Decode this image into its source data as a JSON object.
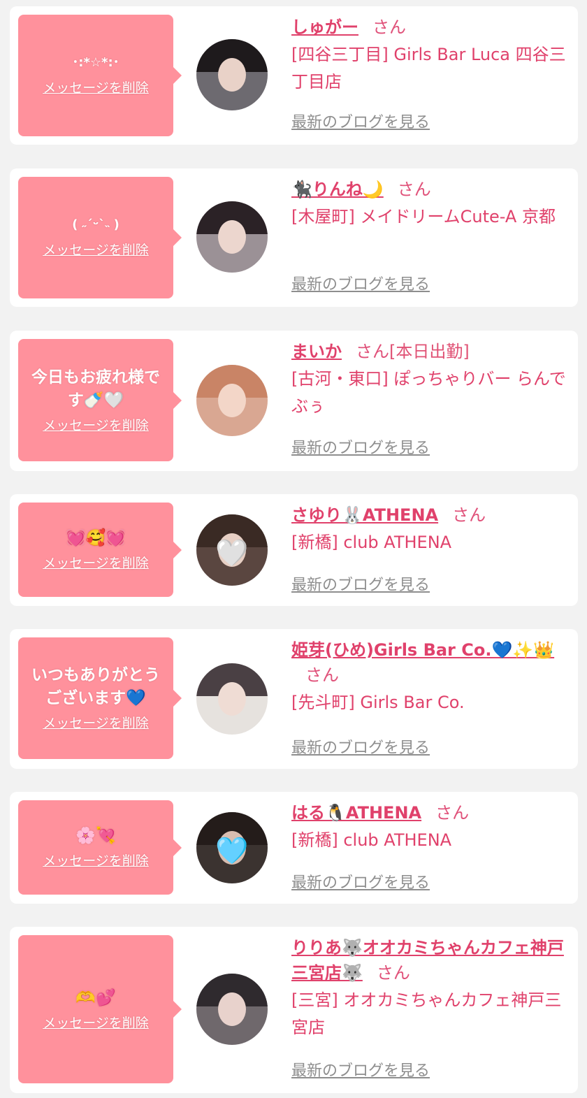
{
  "common": {
    "delete_label": "メッセージを削除",
    "blog_label": "最新のブログを見る",
    "san": "さん"
  },
  "colors": {
    "bubble": "#ff919c",
    "accent": "#e0416b",
    "muted": "#8e8e8e",
    "background": "#f2f2f2"
  },
  "messages": [
    {
      "message": "･:*☆*:･",
      "name": "しゅがー",
      "suffix": "",
      "store": "[四谷三丁目] Girls Bar Luca 四谷三丁目店",
      "avatar": {
        "hair": "#1e1a1c",
        "skin": "#e9d2c8",
        "bg": "#6d6a70",
        "sticker": ""
      }
    },
    {
      "message": "( ˶ˊᵕˋ˵ )",
      "name": "🐈‍⬛りんね🌙",
      "suffix": "",
      "store": "[木屋町] メイドリームCute-A 京都",
      "avatar": {
        "hair": "#2b2226",
        "skin": "#ecd6ce",
        "bg": "#9b9196",
        "sticker": ""
      }
    },
    {
      "message": "今日もお疲れ様です🍼🤍",
      "name": "まいか",
      "suffix": "[本日出勤]",
      "store": "[古河・東口] ぽっちゃりバー らんでぶぅ",
      "avatar": {
        "hair": "#c98466",
        "skin": "#f3d6c8",
        "bg": "#d9a792",
        "sticker": ""
      }
    },
    {
      "message": "💓🥰💓",
      "name": "さゆり🐰ATHENA",
      "suffix": "",
      "store": "[新橋] club ATHENA",
      "avatar": {
        "hair": "#3a2a24",
        "skin": "#e7cfc4",
        "bg": "#5a4640",
        "sticker": "🤍"
      }
    },
    {
      "message": "いつもありがとうございます💙",
      "name": "姫芽(ひめ)Girls Bar Co.💙✨👑",
      "suffix": "",
      "store": "[先斗町] Girls Bar Co.",
      "avatar": {
        "hair": "#4a4044",
        "skin": "#efdcd4",
        "bg": "#e6e2de",
        "sticker": ""
      }
    },
    {
      "message": "🌸💘",
      "name": "はる🐧ATHENA",
      "suffix": "",
      "store": "[新橋] club ATHENA",
      "avatar": {
        "hair": "#241c1a",
        "skin": "#d8bdb0",
        "bg": "#3b3330",
        "sticker": "🩵"
      }
    },
    {
      "message": "🫶💕",
      "name": "りりあ🐺オオカミちゃんカフェ神戸三宮店🐺",
      "suffix": "",
      "store": "[三宮] オオカミちゃんカフェ神戸三宮店",
      "avatar": {
        "hair": "#2f2a2e",
        "skin": "#e8d2cc",
        "bg": "#6f686c",
        "sticker": ""
      }
    }
  ]
}
